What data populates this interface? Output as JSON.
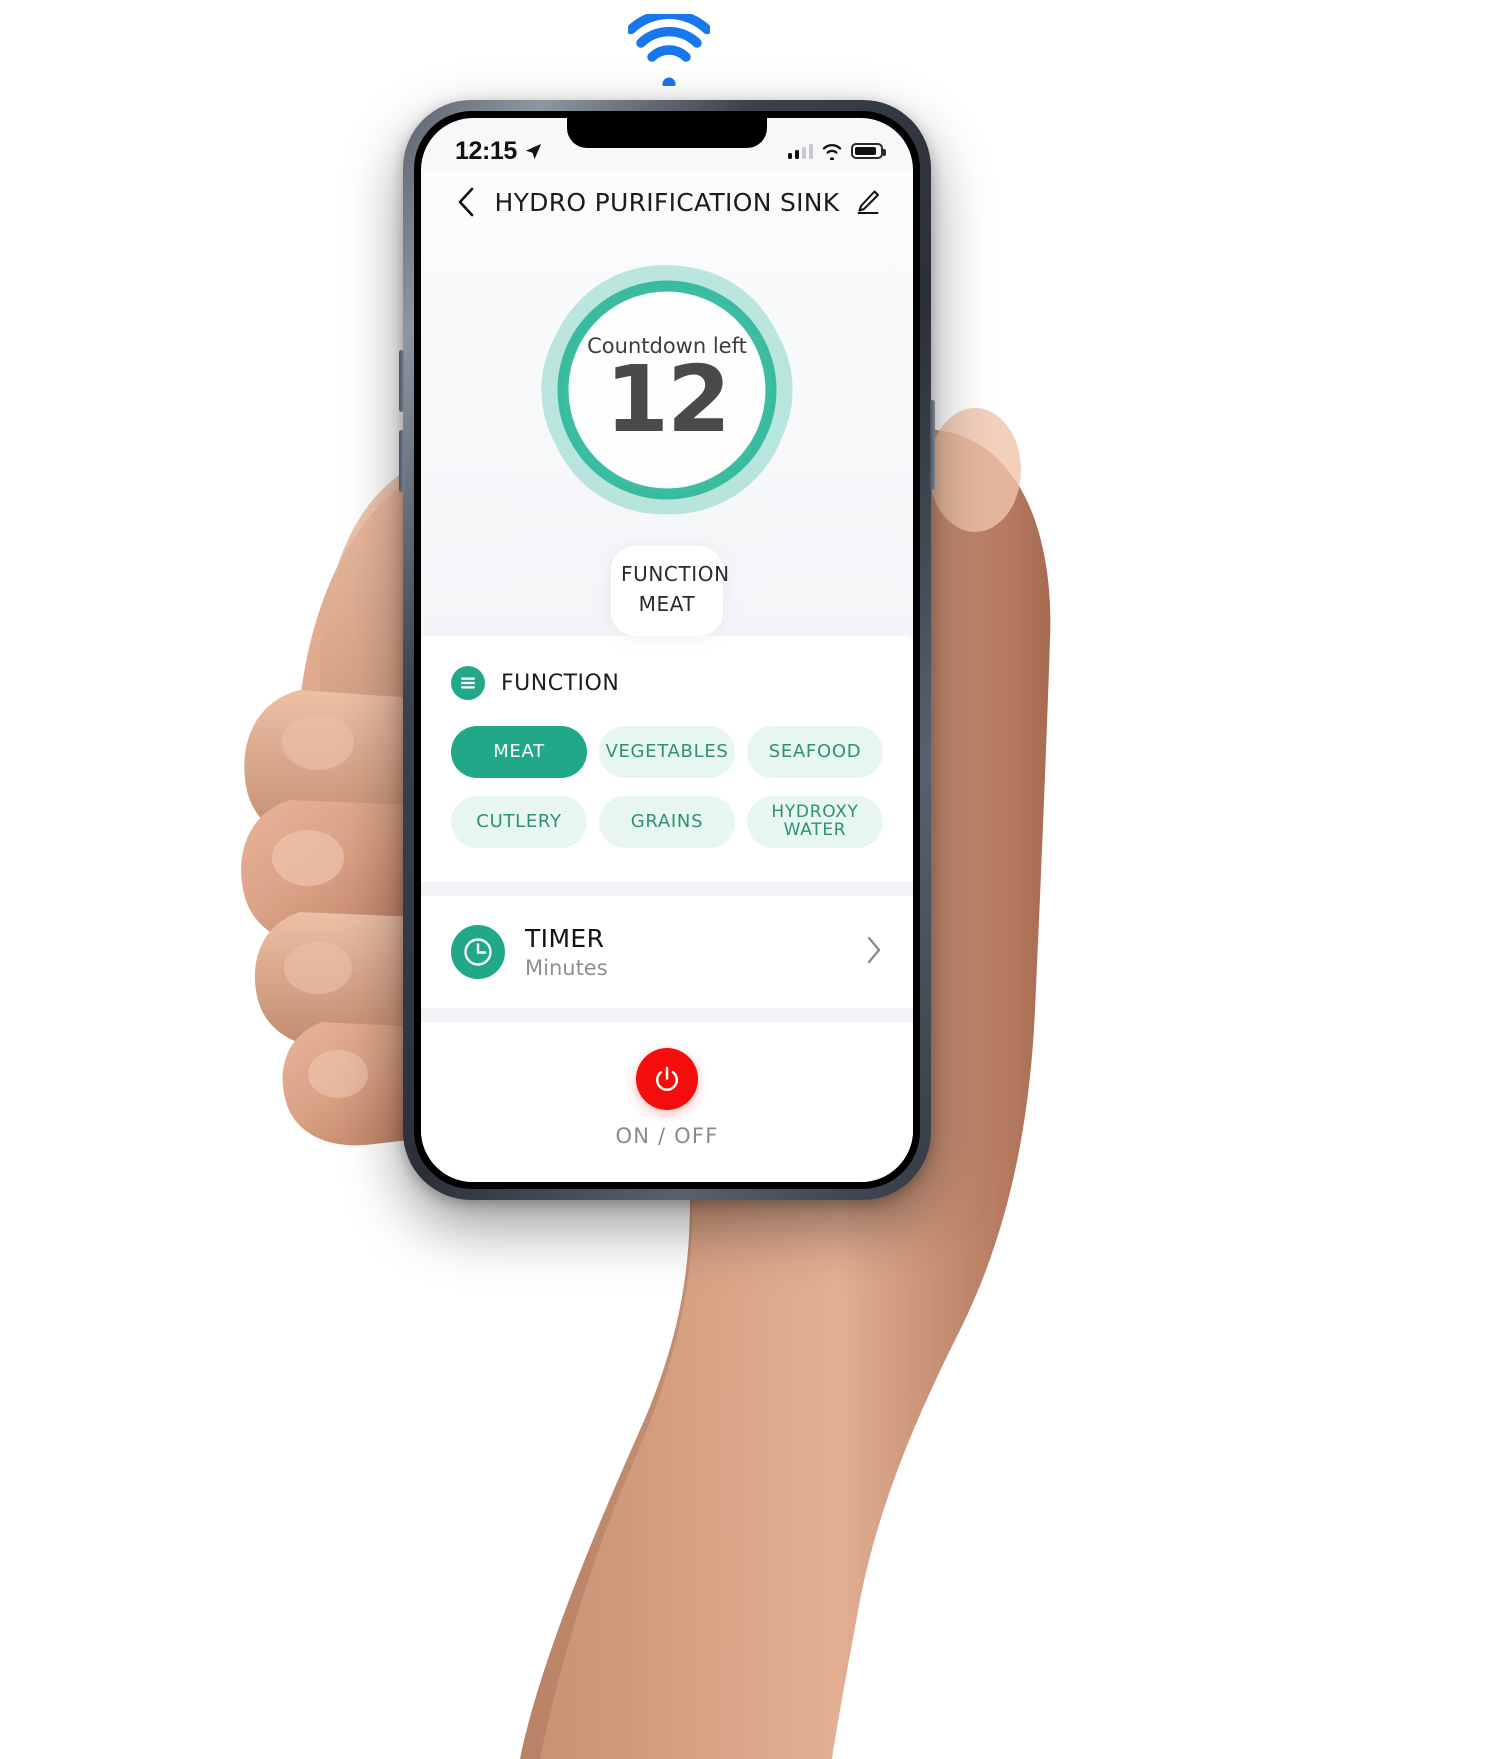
{
  "top_icon": {
    "name": "wifi-broadcast-icon",
    "color": "#1877ea"
  },
  "status_bar": {
    "time": "12:15",
    "location_icon": "location-arrow-icon",
    "signal_icon": "cellular-signal-icon",
    "signal_bars_on": 2,
    "signal_bars_total": 4,
    "wifi_icon": "wifi-icon",
    "battery_icon": "battery-icon"
  },
  "nav": {
    "back_icon": "chevron-left-icon",
    "title": "HYDRO PURIFICATION SINK",
    "edit_icon": "pencil-edit-icon"
  },
  "hero": {
    "dial_label": "Countdown left",
    "dial_value": "12",
    "ring_color": "#3cbfa3",
    "function_key": "FUNCTION",
    "function_value": "MEAT"
  },
  "function_card": {
    "icon": "hamburger-menu-icon",
    "title": "FUNCTION",
    "accent": "#21a888",
    "options": [
      {
        "label": "MEAT",
        "selected": true
      },
      {
        "label": "VEGETABLES",
        "selected": false
      },
      {
        "label": "SEAFOOD",
        "selected": false
      },
      {
        "label": "CUTLERY",
        "selected": false
      },
      {
        "label": "GRAINS",
        "selected": false
      },
      {
        "label": "HYDROXY WATER",
        "selected": false
      }
    ]
  },
  "timer_card": {
    "icon": "clock-icon",
    "title": "TIMER",
    "subtitle": "Minutes",
    "chevron_icon": "chevron-right-icon"
  },
  "power_card": {
    "icon": "power-icon",
    "label": "ON / OFF",
    "color": "#f50d0d"
  }
}
